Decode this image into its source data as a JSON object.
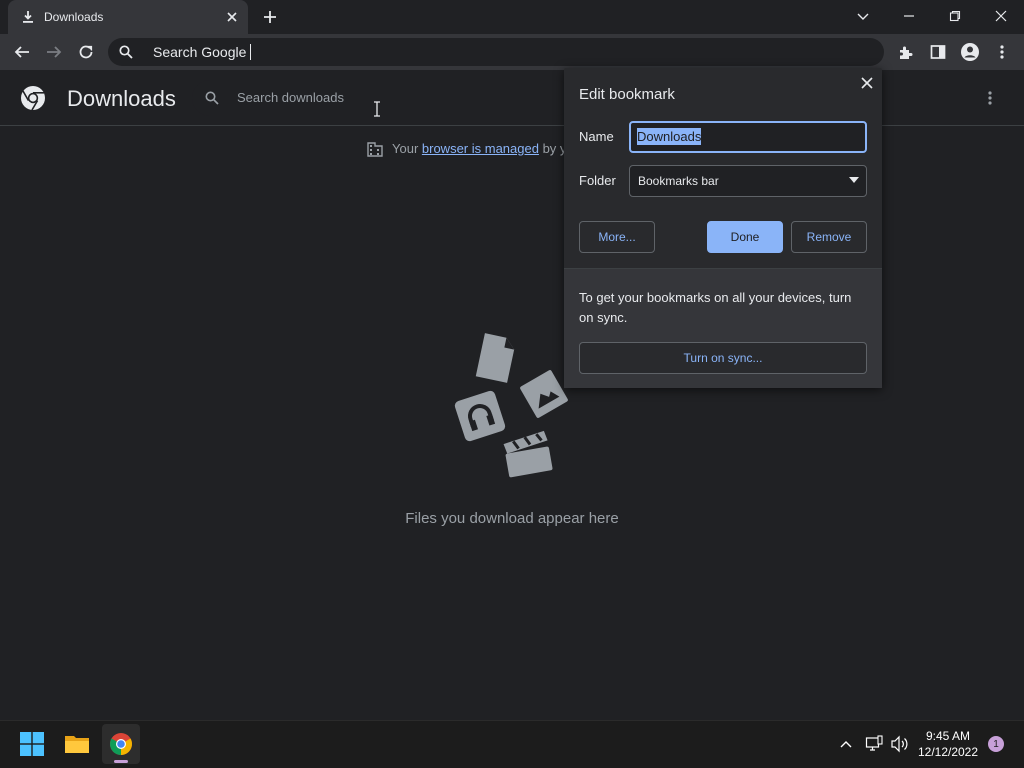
{
  "tab": {
    "title": "Downloads",
    "favicon_icon": "download-icon"
  },
  "omnibox": {
    "text": "Search Google"
  },
  "page": {
    "title": "Downloads",
    "search_placeholder": "Search downloads",
    "managed_prefix": "Your ",
    "managed_link": "browser is managed",
    "managed_suffix": " by y",
    "empty_message": "Files you download appear here"
  },
  "bookmark_bubble": {
    "title": "Edit bookmark",
    "name_label": "Name",
    "name_value": "Downloads",
    "folder_label": "Folder",
    "folder_value": "Bookmarks bar",
    "more_label": "More...",
    "done_label": "Done",
    "remove_label": "Remove",
    "sync_text": "To get your bookmarks on all your devices, turn on sync.",
    "sync_button": "Turn on sync..."
  },
  "taskbar": {
    "time": "9:45 AM",
    "date": "12/12/2022",
    "notification_count": "1"
  },
  "colors": {
    "accent": "#8ab4f8",
    "background": "#202124",
    "toolbar": "#35363a"
  }
}
